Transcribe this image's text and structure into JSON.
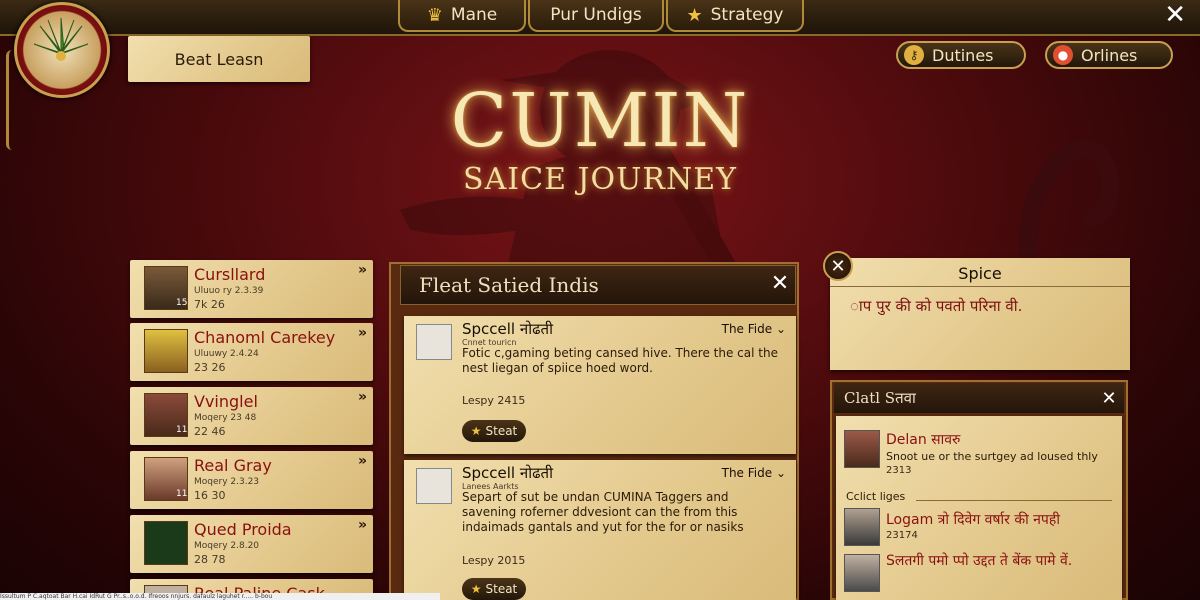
{
  "nav": {
    "tabs": [
      {
        "label": "Mane",
        "icon": "crown-icon"
      },
      {
        "label": "Pur Undigs"
      },
      {
        "label": "Strategy",
        "icon": "star-icon"
      }
    ],
    "close": "✕"
  },
  "side_button": {
    "label": "Beat Leasn"
  },
  "top_right": {
    "duties": {
      "label": "Dutines",
      "icon": "key-icon"
    },
    "online": {
      "label": "Orlines",
      "icon": "avatar-icon"
    }
  },
  "hero": {
    "title": "CUMIN",
    "subtitle": "SAICE JOURNEY"
  },
  "players": [
    {
      "name": "Cursllard",
      "sub": "Uluuo ry 2.3.39",
      "time": "7k 26",
      "badge": "15"
    },
    {
      "name": "Chanoml Carekey",
      "sub": "Uluuwy 2.4.24",
      "time": "23 26",
      "badge": ""
    },
    {
      "name": "Vvinglel",
      "sub": "Moqery 23 48",
      "time": "22 46",
      "badge": "11"
    },
    {
      "name": "Real Gray",
      "sub": "Moqery 2.3.23",
      "time": "16 30",
      "badge": "11"
    },
    {
      "name": "Qued Proida",
      "sub": "Moqery 2.8.20",
      "time": "28 78",
      "badge": ""
    },
    {
      "name": "Real Paline Cask",
      "sub": "",
      "time": "",
      "badge": ""
    }
  ],
  "feed": {
    "title": "Fleat Satied Indis",
    "close": "✕",
    "posts": [
      {
        "author": "Spccell नोढती",
        "meta": "Cnnet touricn",
        "tag": "The Fide",
        "body": "Fotic c,gaming beting cansed hive. There the cal the nest liegan of spiice hoed word.",
        "date": "Lespy 2415",
        "button": "Steat"
      },
      {
        "author": "Spccell नोढती",
        "meta": "Lanees Aarkts",
        "tag": "The Fide",
        "body": "Separt of sut be undan CUMINA Taggers and savening roferner ddvesiont can the from this indaimads gantals and yut for the for or nasiks",
        "date": "Lespy 2015",
        "button": "Steat"
      }
    ]
  },
  "spice": {
    "title": "Spice",
    "body": "ाप पुर की को पवतो परिना वी.",
    "close": "✕"
  },
  "chat": {
    "title": "Clatl Sतवा",
    "close": "✕",
    "section_label": "Cclict liges",
    "messages": [
      {
        "name": "Delan सावरु",
        "text": "Snoot ue or the surtgey ad loused thly",
        "time": "2313"
      },
      {
        "name": "Logam त्रो दिवेग वर्षार की नपही",
        "text": "",
        "time": "23174"
      },
      {
        "name": "Sलतगी पमो प्पो उद्दत ते बेंक पामे वें.",
        "text": "",
        "time": ""
      }
    ]
  },
  "statusbar": {
    "text": "Issultum P C.aqtoat Bar H.cai IdRut G Pr..s..o.o.d. Ifreoos nnjurs. dafaulz laguhet r..... b-bou"
  },
  "colors": {
    "accent_gold": "#c8a050",
    "title_glow": "#f6e7b4",
    "name_red": "#8a1010",
    "parchment": "#f1dfae",
    "bg_red": "#7a1418"
  }
}
